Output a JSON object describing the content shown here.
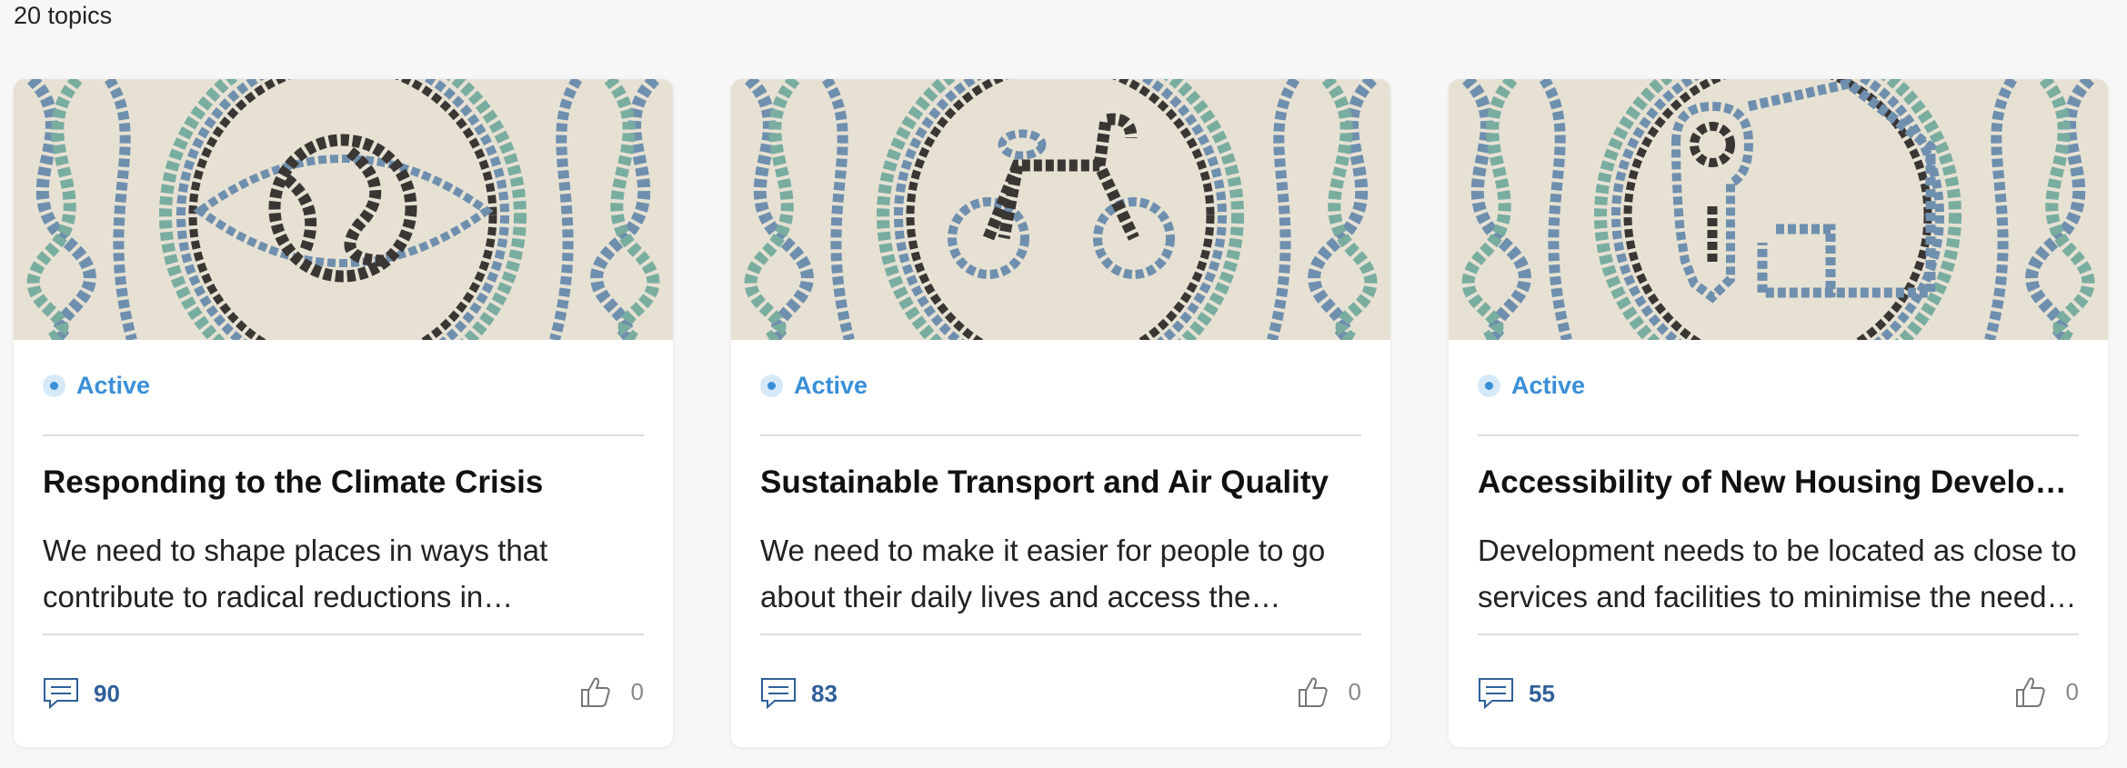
{
  "summary": {
    "count_text": "20 topics"
  },
  "colors": {
    "accent_status": "#3a8fd8",
    "comment_count": "#2f5f99",
    "mosaic_blue": "#6f8fae",
    "mosaic_teal": "#79ada0",
    "mosaic_dark": "#3a3634",
    "mosaic_sand": "#e6e1d3"
  },
  "topics": [
    {
      "status": "Active",
      "title": "Responding to the Climate Crisis",
      "description": "We need to shape places in ways that contribute to radical reductions in greenhouse gas emissions",
      "comments": "90",
      "likes": "0",
      "image_icon": "eye-globe-icon"
    },
    {
      "status": "Active",
      "title": "Sustainable Transport and Air Quality",
      "description": "We need to make it easier for people to go about their daily lives and access the services they need",
      "comments": "83",
      "likes": "0",
      "image_icon": "bicycle-icon"
    },
    {
      "status": "Active",
      "title": "Accessibility of New Housing Developments",
      "description": "Development needs to be located as close to services and facilities to minimise the need to travel",
      "comments": "55",
      "likes": "0",
      "image_icon": "key-house-icon"
    }
  ]
}
